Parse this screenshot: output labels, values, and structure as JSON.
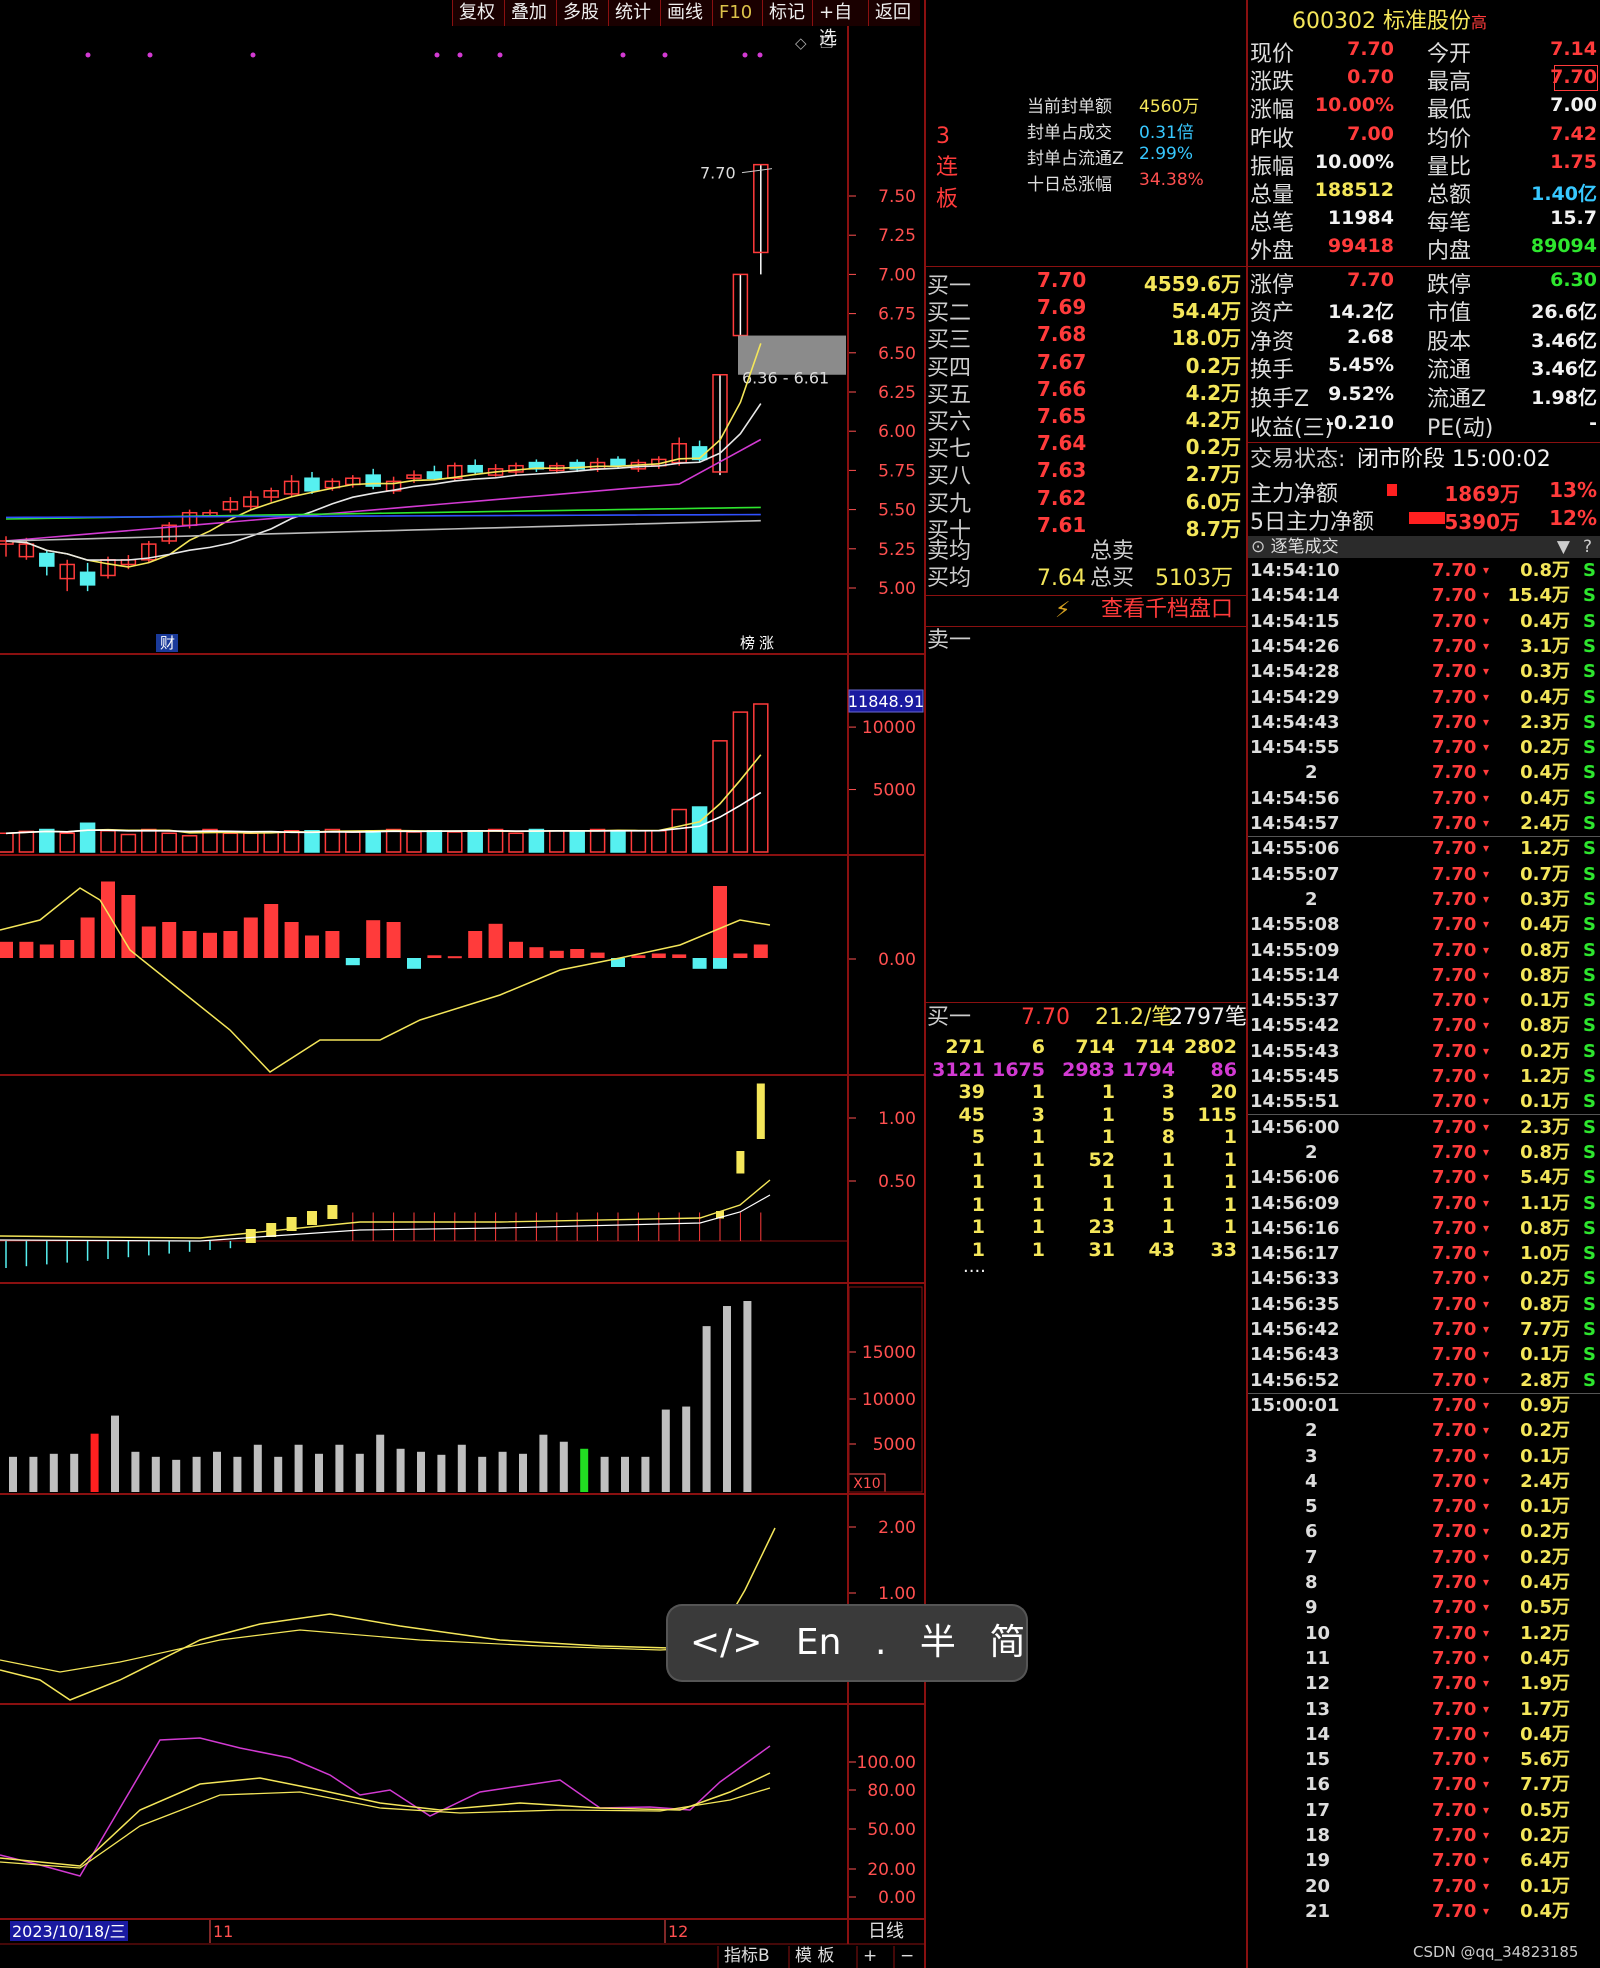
{
  "toolbar": {
    "buttons": [
      "复权",
      "叠加",
      "多股",
      "统计",
      "画线",
      "F10",
      "标记",
      "+自选",
      "返回"
    ]
  },
  "stock": {
    "code": "600302",
    "name": "标准股份",
    "tag": "高"
  },
  "price_axis": [
    "7.50",
    "7.25",
    "7.00",
    "6.75",
    "6.50",
    "6.25",
    "6.00",
    "5.75",
    "5.50",
    "5.25",
    "5.00"
  ],
  "price_markers": {
    "high_label": "7.70",
    "gap_label": "6.36 - 6.61",
    "cai": "财",
    "bang": "榜",
    "zhang": "涨"
  },
  "seal_info": {
    "lianban": "3连板",
    "rows": [
      {
        "label": "当前封单额",
        "value": "4560万"
      },
      {
        "label": "封单占成交",
        "value": "0.31倍"
      },
      {
        "label": "封单占流通Z",
        "value": "2.99%"
      },
      {
        "label": "十日总涨幅",
        "value": "34.38%"
      }
    ]
  },
  "volume_axis": {
    "badge": "11848.91",
    "ticks": [
      "10000",
      "5000"
    ]
  },
  "macd_axis": {
    "ticks": [
      "0.00"
    ]
  },
  "ind3_axis": {
    "ticks": [
      "1.00",
      "0.50"
    ]
  },
  "ind4_axis": {
    "ticks": [
      "15000",
      "10000",
      "5000"
    ],
    "unit": "X10"
  },
  "ind5_axis": {
    "ticks": [
      "2.00",
      "1.00"
    ]
  },
  "ind6_axis": {
    "ticks": [
      "100.00",
      "80.00",
      "50.00",
      "20.00",
      "0.00"
    ]
  },
  "date_bar": {
    "date": "2023/10/18/三",
    "m11": "11",
    "m12": "12",
    "period": "日线"
  },
  "bottom_bar": {
    "btn1": "指标B",
    "btn2": "模 板",
    "plus": "+",
    "minus": "−"
  },
  "quote": [
    {
      "l1": "现价",
      "v1": "7.70",
      "l2": "今开",
      "v2": "7.14"
    },
    {
      "l1": "涨跌",
      "v1": "0.70",
      "l2": "最高",
      "v2": "7.70"
    },
    {
      "l1": "涨幅",
      "v1": "10.00%",
      "l2": "最低",
      "v2": "7.00"
    },
    {
      "l1": "昨收",
      "v1": "7.00",
      "l2": "均价",
      "v2": "7.42"
    },
    {
      "l1": "振幅",
      "v1": "10.00%",
      "l2": "量比",
      "v2": "1.75"
    },
    {
      "l1": "总量",
      "v1": "188512",
      "l2": "总额",
      "v2": "1.40亿"
    },
    {
      "l1": "总笔",
      "v1": "11984",
      "l2": "每笔",
      "v2": "15.7"
    },
    {
      "l1": "外盘",
      "v1": "99418",
      "l2": "内盘",
      "v2": "89094"
    },
    {
      "l1": "涨停",
      "v1": "7.70",
      "l2": "跌停",
      "v2": "6.30"
    },
    {
      "l1": "资产",
      "v1": "14.2亿",
      "l2": "市值",
      "v2": "26.6亿"
    },
    {
      "l1": "净资",
      "v1": "2.68",
      "l2": "股本",
      "v2": "3.46亿"
    },
    {
      "l1": "换手",
      "v1": "5.45%",
      "l2": "流通",
      "v2": "3.46亿"
    },
    {
      "l1": "换手Z",
      "v1": "9.52%",
      "l2": "流通Z",
      "v2": "1.98亿"
    },
    {
      "l1": "收益(三)",
      "v1": "-0.210",
      "l2": "PE(动)",
      "v2": "-"
    }
  ],
  "trade_state": {
    "label": "交易状态:",
    "value": "闭市阶段 15:00:02"
  },
  "main_flow": [
    {
      "label": "主力净额",
      "value": "1869万",
      "pct": "13%"
    },
    {
      "label": "5日主力净额",
      "value": "5390万",
      "pct": "12%"
    }
  ],
  "ticks_header": "逐笔成交",
  "ticks": [
    [
      "14:54:10",
      "7.70",
      "0.8万",
      "S"
    ],
    [
      "14:54:14",
      "7.70",
      "15.4万",
      "S"
    ],
    [
      "14:54:15",
      "7.70",
      "0.4万",
      "S"
    ],
    [
      "14:54:26",
      "7.70",
      "3.1万",
      "S"
    ],
    [
      "14:54:28",
      "7.70",
      "0.3万",
      "S"
    ],
    [
      "14:54:29",
      "7.70",
      "0.4万",
      "S"
    ],
    [
      "14:54:43",
      "7.70",
      "2.3万",
      "S"
    ],
    [
      "14:54:55",
      "7.70",
      "0.2万",
      "S"
    ],
    [
      "2",
      "7.70",
      "0.4万",
      "S"
    ],
    [
      "14:54:56",
      "7.70",
      "0.4万",
      "S"
    ],
    [
      "14:54:57",
      "7.70",
      "2.4万",
      "S"
    ],
    [
      "14:55:06",
      "7.70",
      "1.2万",
      "S"
    ],
    [
      "14:55:07",
      "7.70",
      "0.7万",
      "S"
    ],
    [
      "2",
      "7.70",
      "0.3万",
      "S"
    ],
    [
      "14:55:08",
      "7.70",
      "0.4万",
      "S"
    ],
    [
      "14:55:09",
      "7.70",
      "0.8万",
      "S"
    ],
    [
      "14:55:14",
      "7.70",
      "0.8万",
      "S"
    ],
    [
      "14:55:37",
      "7.70",
      "0.1万",
      "S"
    ],
    [
      "14:55:42",
      "7.70",
      "0.8万",
      "S"
    ],
    [
      "14:55:43",
      "7.70",
      "0.2万",
      "S"
    ],
    [
      "14:55:45",
      "7.70",
      "1.2万",
      "S"
    ],
    [
      "14:55:51",
      "7.70",
      "0.1万",
      "S"
    ],
    [
      "14:56:00",
      "7.70",
      "2.3万",
      "S"
    ],
    [
      "2",
      "7.70",
      "0.8万",
      "S"
    ],
    [
      "14:56:06",
      "7.70",
      "5.4万",
      "S"
    ],
    [
      "14:56:09",
      "7.70",
      "1.1万",
      "S"
    ],
    [
      "14:56:16",
      "7.70",
      "0.8万",
      "S"
    ],
    [
      "14:56:17",
      "7.70",
      "1.0万",
      "S"
    ],
    [
      "14:56:33",
      "7.70",
      "0.2万",
      "S"
    ],
    [
      "14:56:35",
      "7.70",
      "0.8万",
      "S"
    ],
    [
      "14:56:42",
      "7.70",
      "7.7万",
      "S"
    ],
    [
      "14:56:43",
      "7.70",
      "0.1万",
      "S"
    ],
    [
      "14:56:52",
      "7.70",
      "2.8万",
      "S"
    ],
    [
      "15:00:01",
      "7.70",
      "0.9万",
      ""
    ],
    [
      "2",
      "7.70",
      "0.2万",
      ""
    ],
    [
      "3",
      "7.70",
      "0.1万",
      ""
    ],
    [
      "4",
      "7.70",
      "2.4万",
      ""
    ],
    [
      "5",
      "7.70",
      "0.1万",
      ""
    ],
    [
      "6",
      "7.70",
      "0.2万",
      ""
    ],
    [
      "7",
      "7.70",
      "0.2万",
      ""
    ],
    [
      "8",
      "7.70",
      "0.4万",
      ""
    ],
    [
      "9",
      "7.70",
      "0.5万",
      ""
    ],
    [
      "10",
      "7.70",
      "1.2万",
      ""
    ],
    [
      "11",
      "7.70",
      "0.4万",
      ""
    ],
    [
      "12",
      "7.70",
      "1.9万",
      ""
    ],
    [
      "13",
      "7.70",
      "1.7万",
      ""
    ],
    [
      "14",
      "7.70",
      "0.4万",
      ""
    ],
    [
      "15",
      "7.70",
      "5.6万",
      ""
    ],
    [
      "16",
      "7.70",
      "7.7万",
      ""
    ],
    [
      "17",
      "7.70",
      "0.5万",
      ""
    ],
    [
      "18",
      "7.70",
      "0.2万",
      ""
    ],
    [
      "19",
      "7.70",
      "6.4万",
      ""
    ],
    [
      "20",
      "7.70",
      "0.1万",
      ""
    ],
    [
      "21",
      "7.70",
      "0.4万",
      ""
    ]
  ],
  "order_book": [
    {
      "label": "买一",
      "price": "7.70",
      "vol": "4559.6万"
    },
    {
      "label": "买二",
      "price": "7.69",
      "vol": "54.4万"
    },
    {
      "label": "买三",
      "price": "7.68",
      "vol": "18.0万"
    },
    {
      "label": "买四",
      "price": "7.67",
      "vol": "0.2万"
    },
    {
      "label": "买五",
      "price": "7.66",
      "vol": "4.2万"
    },
    {
      "label": "买六",
      "price": "7.65",
      "vol": "4.2万"
    },
    {
      "label": "买七",
      "price": "7.64",
      "vol": "0.2万"
    },
    {
      "label": "买八",
      "price": "7.63",
      "vol": "2.7万"
    },
    {
      "label": "买九",
      "price": "7.62",
      "vol": "6.0万"
    },
    {
      "label": "买十",
      "price": "7.61",
      "vol": "8.7万"
    }
  ],
  "avg": {
    "sell_label": "卖均",
    "sell_total": "总卖",
    "buy_label": "买均",
    "buy_price": "7.64",
    "buy_total": "总买",
    "buy_total_v": "5103万"
  },
  "thousand": "查看千档盘口",
  "sell_one": "卖一",
  "queue": {
    "label": "买一",
    "price": "7.70",
    "per": "21.2/笔",
    "count": "2797笔",
    "rows": [
      [
        "271",
        "6",
        "714",
        "714",
        "2802"
      ],
      [
        "3121",
        "1675",
        "2983",
        "1794",
        "86"
      ],
      [
        "39",
        "1",
        "1",
        "3",
        "20"
      ],
      [
        "45",
        "3",
        "1",
        "5",
        "115"
      ],
      [
        "5",
        "1",
        "1",
        "8",
        "1"
      ],
      [
        "1",
        "1",
        "52",
        "1",
        "1"
      ],
      [
        "1",
        "1",
        "1",
        "1",
        "1"
      ],
      [
        "1",
        "1",
        "1",
        "1",
        "1"
      ],
      [
        "1",
        "1",
        "23",
        "1",
        "1"
      ],
      [
        "1",
        "1",
        "31",
        "43",
        "33"
      ]
    ],
    "more": "...."
  },
  "ime": {
    "code": "</>",
    "en": "En",
    "dot": ".",
    "half": "半",
    "simp": "简"
  },
  "watermark": "CSDN @qq_34823185",
  "colors": {
    "up": "#ff3b3b",
    "down": "#56f0f0",
    "ma": "#f4e65a",
    "grid": "#8a1010"
  }
}
